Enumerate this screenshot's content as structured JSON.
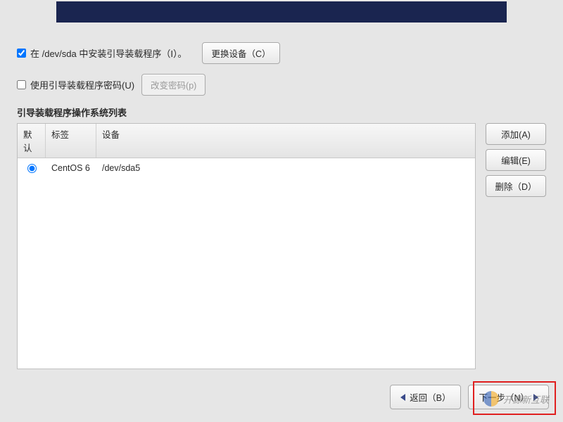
{
  "banner": {},
  "install_bootloader": {
    "checked": true,
    "label": "在 /dev/sda 中安装引导装载程序（I）。",
    "change_device_btn": "更换设备（C）"
  },
  "use_password": {
    "checked": false,
    "label": "使用引导装载程序密码(U)",
    "change_password_btn": "改变密码(p)"
  },
  "os_list": {
    "title": "引导装载程序操作系统列表",
    "columns": {
      "default": "默认",
      "label": "标签",
      "device": "设备"
    },
    "rows": [
      {
        "default": true,
        "label": "CentOS 6",
        "device": "/dev/sda5"
      }
    ],
    "buttons": {
      "add": "添加(A)",
      "edit": "编辑(E)",
      "delete": "删除（D）"
    }
  },
  "footer": {
    "back": "返回（B）",
    "next": "下一步（N）"
  },
  "watermark": {
    "text": "开源新互联"
  }
}
